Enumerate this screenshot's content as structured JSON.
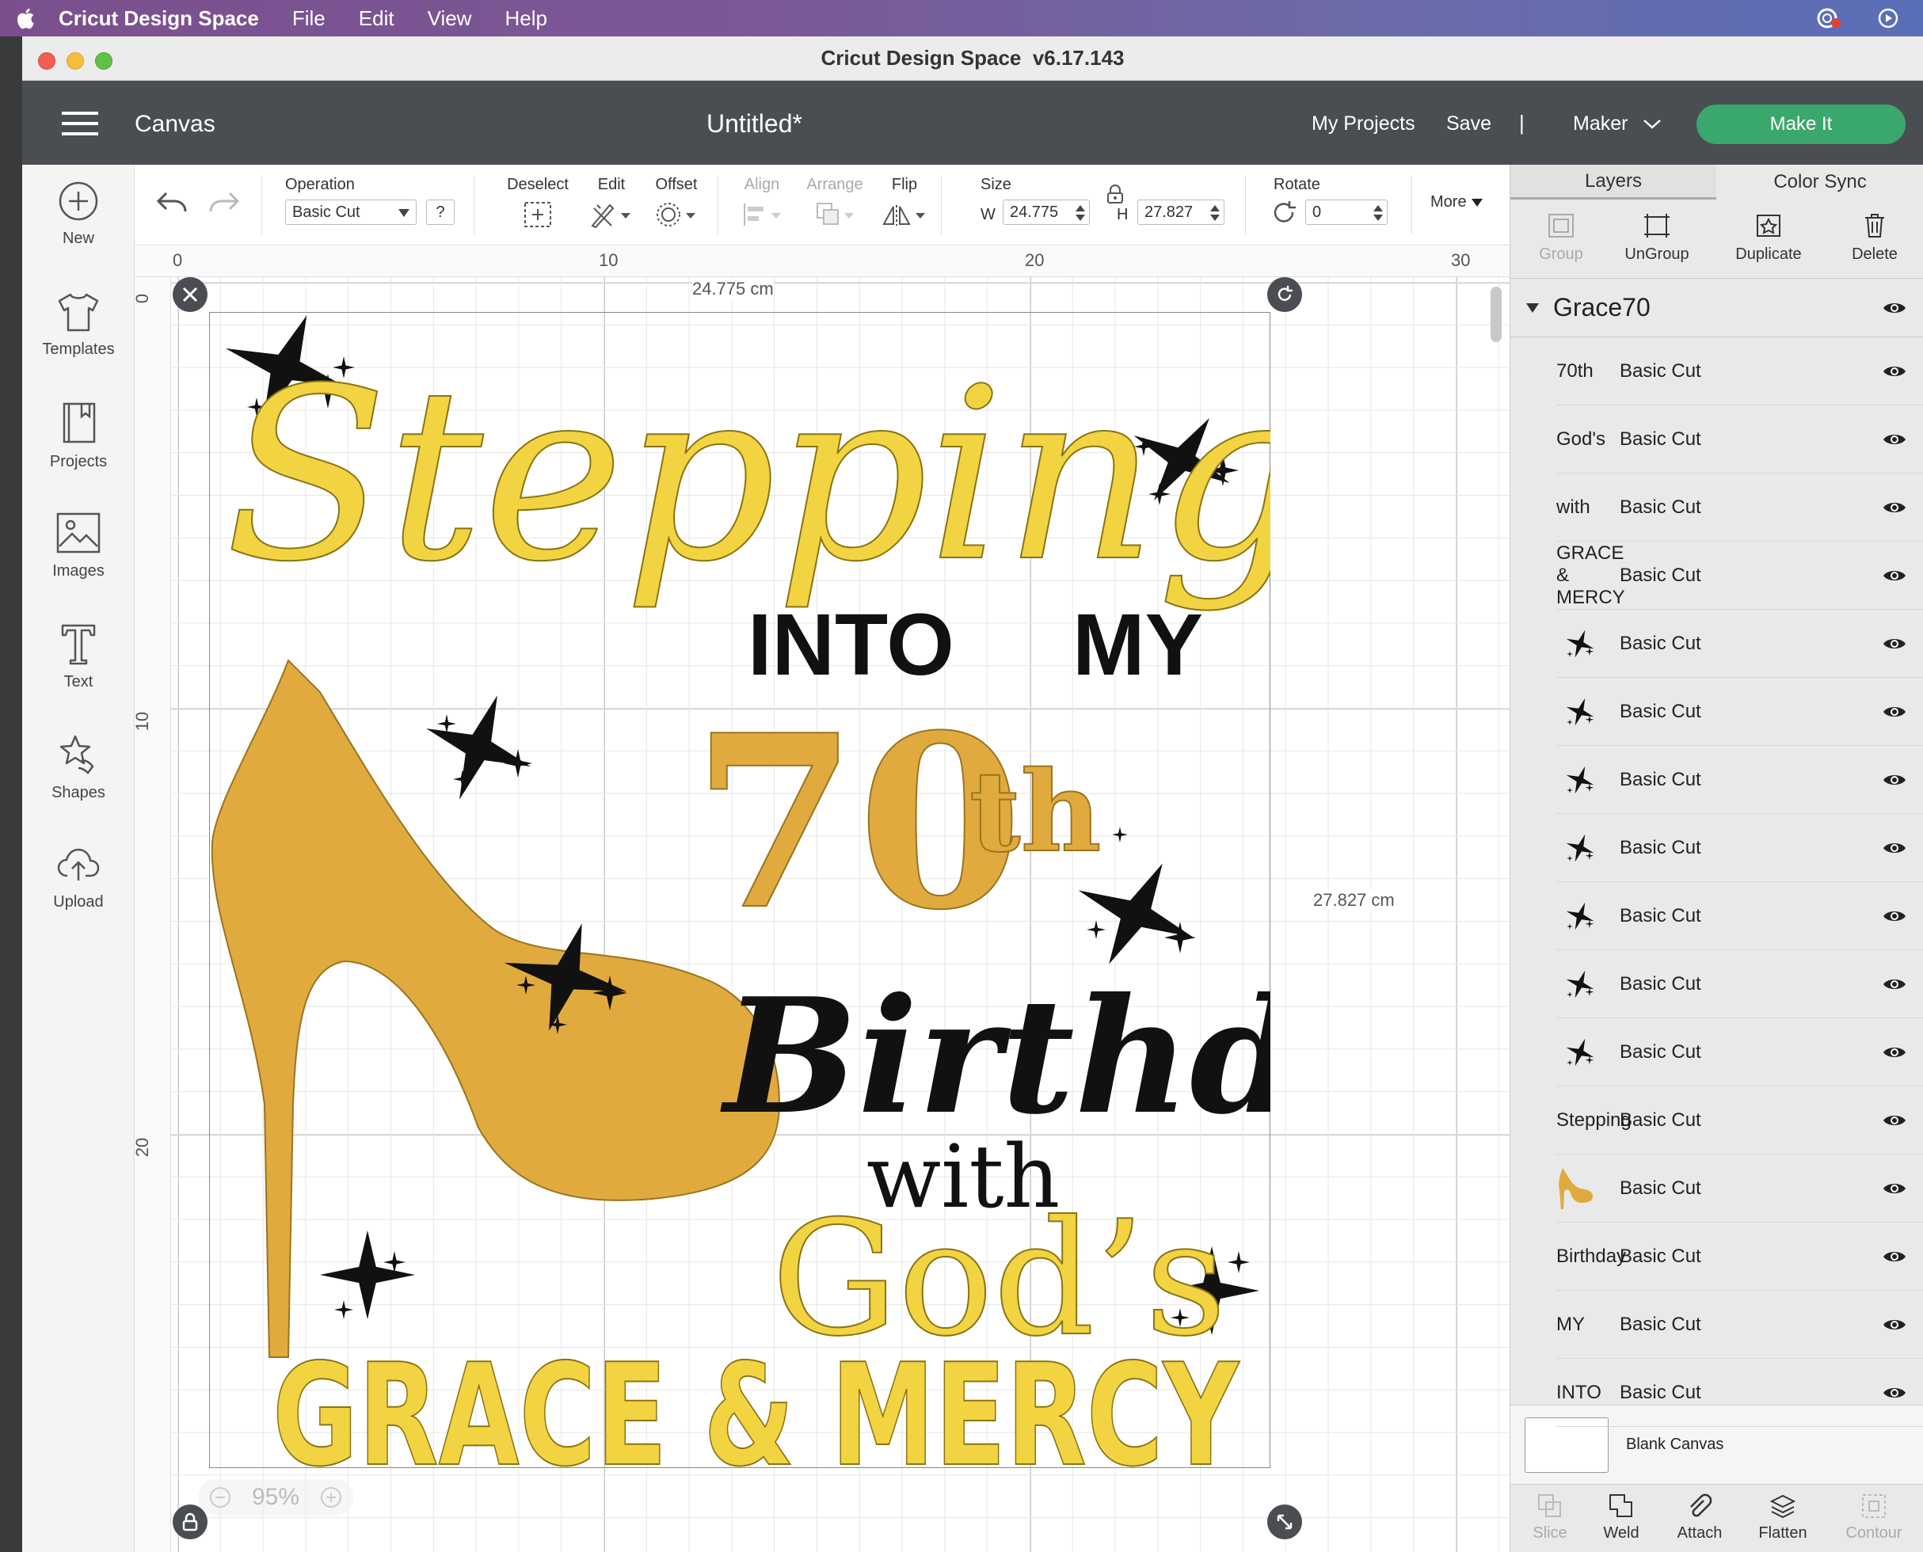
{
  "menubar": {
    "app_name": "Cricut Design Space",
    "items": [
      "File",
      "Edit",
      "View",
      "Help"
    ]
  },
  "window": {
    "title": "Cricut Design Space  v6.17.143"
  },
  "header": {
    "section": "Canvas",
    "doc_title": "Untitled*",
    "my_projects": "My Projects",
    "save": "Save",
    "divider": "|",
    "machine": "Maker",
    "make_it": "Make It"
  },
  "toolbar": {
    "operation_label": "Operation",
    "operation_value": "Basic Cut",
    "help": "?",
    "deselect": "Deselect",
    "edit": "Edit",
    "offset": "Offset",
    "align": "Align",
    "arrange": "Arrange",
    "flip": "Flip",
    "size_label": "Size",
    "w_label": "W",
    "w_value": "24.775",
    "h_label": "H",
    "h_value": "27.827",
    "rotate_label": "Rotate",
    "rotate_value": "0",
    "more": "More"
  },
  "leftbar": [
    {
      "label": "New",
      "icon": "plus-circle-icon"
    },
    {
      "label": "Templates",
      "icon": "tshirt-icon"
    },
    {
      "label": "Projects",
      "icon": "book-icon"
    },
    {
      "label": "Images",
      "icon": "image-icon"
    },
    {
      "label": "Text",
      "icon": "text-t-icon"
    },
    {
      "label": "Shapes",
      "icon": "shapes-icon"
    },
    {
      "label": "Upload",
      "icon": "cloud-upload-icon"
    }
  ],
  "ruler": {
    "top": [
      "0",
      "10",
      "20",
      "30"
    ],
    "left": [
      "0",
      "10",
      "20"
    ]
  },
  "canvas": {
    "width_readout": "24.775 cm",
    "height_readout": "27.827 cm",
    "zoom": "95%",
    "design": {
      "stepping": "Stepping",
      "into": "INTO",
      "my": "MY",
      "seventy": "70",
      "th": "th",
      "birthday": "Birthday",
      "with": "with",
      "gods": "God’s",
      "grace": "GRACE & MERCY"
    }
  },
  "rpanel": {
    "tabs": [
      "Layers",
      "Color Sync"
    ],
    "actions": [
      {
        "label": "Group",
        "enabled": false
      },
      {
        "label": "UnGroup",
        "enabled": true
      },
      {
        "label": "Duplicate",
        "enabled": true
      },
      {
        "label": "Delete",
        "enabled": true
      }
    ],
    "group_name": "Grace70",
    "layers": [
      {
        "thumb": "70th",
        "name": "Basic Cut",
        "kind": "text-gold"
      },
      {
        "thumb": "God's",
        "name": "Basic Cut",
        "kind": "text-yellow"
      },
      {
        "thumb": "with",
        "name": "Basic Cut",
        "kind": "text-serif"
      },
      {
        "thumb": "GRACE & MERCY",
        "name": "Basic Cut",
        "kind": "text-tiny"
      },
      {
        "thumb": "",
        "name": "Basic Cut",
        "kind": "star"
      },
      {
        "thumb": "",
        "name": "Basic Cut",
        "kind": "star"
      },
      {
        "thumb": "",
        "name": "Basic Cut",
        "kind": "star"
      },
      {
        "thumb": "",
        "name": "Basic Cut",
        "kind": "star"
      },
      {
        "thumb": "",
        "name": "Basic Cut",
        "kind": "star"
      },
      {
        "thumb": "",
        "name": "Basic Cut",
        "kind": "star"
      },
      {
        "thumb": "",
        "name": "Basic Cut",
        "kind": "star"
      },
      {
        "thumb": "Stepping",
        "name": "Basic Cut",
        "kind": "text-script"
      },
      {
        "thumb": "",
        "name": "Basic Cut",
        "kind": "shoe"
      },
      {
        "thumb": "Birthday",
        "name": "Basic Cut",
        "kind": "text-script-black"
      },
      {
        "thumb": "MY",
        "name": "Basic Cut",
        "kind": "text-bold"
      },
      {
        "thumb": "INTO",
        "name": "Basic Cut",
        "kind": "text-bold-small"
      }
    ],
    "blank_canvas": "Blank Canvas",
    "bottom_actions": [
      {
        "label": "Slice",
        "enabled": false
      },
      {
        "label": "Weld",
        "enabled": true
      },
      {
        "label": "Attach",
        "enabled": true
      },
      {
        "label": "Flatten",
        "enabled": true
      },
      {
        "label": "Contour",
        "enabled": false
      }
    ]
  },
  "colors": {
    "accent_green": "#3aa76d",
    "header_bg": "#4a4d52",
    "gold": "#e0aa3e",
    "yellow": "#f2d342"
  }
}
